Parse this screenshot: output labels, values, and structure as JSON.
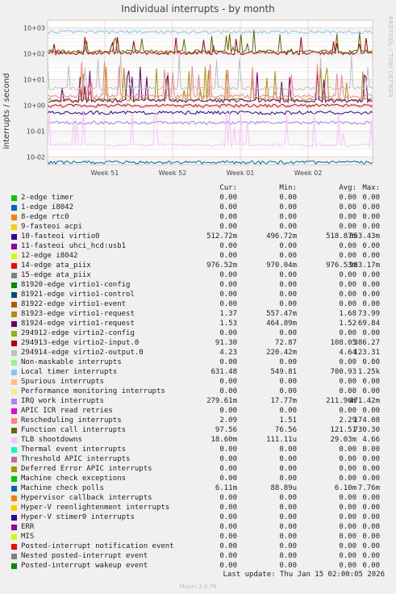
{
  "title": "Individual interrupts - by month",
  "watermark": "RRDTOOL / TOBI OETIKER",
  "footer": {
    "last_update": "Last update: Thu Jan 15 02:00:05 2026",
    "generator": "Munin 2.0.76"
  },
  "columns": {
    "cur": "Cur:",
    "min": "Min:",
    "avg": "Avg:",
    "max": "Max:"
  },
  "chart_data": {
    "type": "line",
    "title": "Individual interrupts - by month",
    "ylabel": "interrupts / second",
    "yscale": "log",
    "y_ticks": [
      {
        "value": 1000,
        "label": "10+03"
      },
      {
        "value": 100,
        "label": "10+02"
      },
      {
        "value": 10,
        "label": "10+01"
      },
      {
        "value": 1,
        "label": "10+00"
      },
      {
        "value": 0.1,
        "label": "10-01"
      },
      {
        "value": 0.01,
        "label": "10-02"
      }
    ],
    "ylim": [
      0.005,
      2000
    ],
    "x_ticks": [
      "Week 51",
      "Week 52",
      "Week 01",
      "Week 02"
    ],
    "grid": true,
    "series": [
      {
        "name": "2-edge timer",
        "color": "#00cc00",
        "cur": "0.00",
        "min": "0.00",
        "avg": "0.00",
        "max": "0.00"
      },
      {
        "name": "1-edge i8042",
        "color": "#0066b3",
        "cur": "0.00",
        "min": "0.00",
        "avg": "0.00",
        "max": "0.00"
      },
      {
        "name": "8-edge rtc0",
        "color": "#ff8000",
        "cur": "0.00",
        "min": "0.00",
        "avg": "0.00",
        "max": "0.00"
      },
      {
        "name": "9-fasteoi acpi",
        "color": "#ffcc00",
        "cur": "0.00",
        "min": "0.00",
        "avg": "0.00",
        "max": "0.00"
      },
      {
        "name": "10-fasteoi virtio0",
        "color": "#330099",
        "cur": "512.72m",
        "min": "496.72m",
        "avg": "518.87m",
        "max": "853.43m"
      },
      {
        "name": "11-fasteoi uhci_hcd:usb1",
        "color": "#990099",
        "cur": "0.00",
        "min": "0.00",
        "avg": "0.00",
        "max": "0.00"
      },
      {
        "name": "12-edge i8042",
        "color": "#ccff00",
        "cur": "0.00",
        "min": "0.00",
        "avg": "0.00",
        "max": "0.00"
      },
      {
        "name": "14-edge ata_piix",
        "color": "#ff0000",
        "cur": "976.52m",
        "min": "970.04m",
        "avg": "976.53m",
        "max": "983.17m"
      },
      {
        "name": "15-edge ata_piix",
        "color": "#808080",
        "cur": "0.00",
        "min": "0.00",
        "avg": "0.00",
        "max": "0.00"
      },
      {
        "name": "81920-edge virtio1-config",
        "color": "#008f00",
        "cur": "0.00",
        "min": "0.00",
        "avg": "0.00",
        "max": "0.00"
      },
      {
        "name": "81921-edge virtio1-control",
        "color": "#00487d",
        "cur": "0.00",
        "min": "0.00",
        "avg": "0.00",
        "max": "0.00"
      },
      {
        "name": "81922-edge virtio1-event",
        "color": "#b35a00",
        "cur": "0.00",
        "min": "0.00",
        "avg": "0.00",
        "max": "0.00"
      },
      {
        "name": "81923-edge virtio1-request",
        "color": "#b38f00",
        "cur": "1.37",
        "min": "557.47m",
        "avg": "1.68",
        "max": "73.99"
      },
      {
        "name": "81924-edge virtio1-request",
        "color": "#6b006b",
        "cur": "1.53",
        "min": "464.89m",
        "avg": "1.52",
        "max": "69.84"
      },
      {
        "name": "294912-edge virtio2-config",
        "color": "#8fb300",
        "cur": "0.00",
        "min": "0.00",
        "avg": "0.00",
        "max": "0.00"
      },
      {
        "name": "294913-edge virtio2-input.0",
        "color": "#b30000",
        "cur": "91.30",
        "min": "72.87",
        "avg": "108.05",
        "max": "386.27"
      },
      {
        "name": "294914-edge virtio2-output.0",
        "color": "#bebebe",
        "cur": "4.23",
        "min": "220.42m",
        "avg": "4.64",
        "max": "123.31"
      },
      {
        "name": "Non-maskable interrupts",
        "color": "#80ff80",
        "cur": "0.00",
        "min": "0.00",
        "avg": "0.00",
        "max": "0.00"
      },
      {
        "name": "Local timer interrupts",
        "color": "#80c9ff",
        "cur": "631.48",
        "min": "549.81",
        "avg": "700.93",
        "max": "1.25k"
      },
      {
        "name": "Spurious interrupts",
        "color": "#ffc080",
        "cur": "0.00",
        "min": "0.00",
        "avg": "0.00",
        "max": "0.00"
      },
      {
        "name": "Performance monitoring interrupts",
        "color": "#ffe680",
        "cur": "0.00",
        "min": "0.00",
        "avg": "0.00",
        "max": "0.00"
      },
      {
        "name": "IRQ work interrupts",
        "color": "#aa80ff",
        "cur": "279.61m",
        "min": "17.77m",
        "avg": "211.96m",
        "max": "471.42m"
      },
      {
        "name": "APIC ICR read retries",
        "color": "#ee00cc",
        "cur": "0.00",
        "min": "0.00",
        "avg": "0.00",
        "max": "0.00"
      },
      {
        "name": "Rescheduling interrupts",
        "color": "#ff8080",
        "cur": "2.09",
        "min": "1.51",
        "avg": "2.29",
        "max": "174.08"
      },
      {
        "name": "Function call interrupts",
        "color": "#666600",
        "cur": "97.56",
        "min": "76.56",
        "avg": "121.51",
        "max": "730.30"
      },
      {
        "name": "TLB shootdowns",
        "color": "#ffbfff",
        "cur": "18.60m",
        "min": "111.11u",
        "avg": "29.03m",
        "max": "4.66"
      },
      {
        "name": "Thermal event interrupts",
        "color": "#00ffcc",
        "cur": "0.00",
        "min": "0.00",
        "avg": "0.00",
        "max": "0.00"
      },
      {
        "name": "Threshold APIC interrupts",
        "color": "#cc6699",
        "cur": "0.00",
        "min": "0.00",
        "avg": "0.00",
        "max": "0.00"
      },
      {
        "name": "Deferred Error APIC interrupts",
        "color": "#999900",
        "cur": "0.00",
        "min": "0.00",
        "avg": "0.00",
        "max": "0.00"
      },
      {
        "name": "Machine check exceptions",
        "color": "#00cc00",
        "cur": "0.00",
        "min": "0.00",
        "avg": "0.00",
        "max": "0.00"
      },
      {
        "name": "Machine check polls",
        "color": "#0066b3",
        "cur": "6.11m",
        "min": "88.89u",
        "avg": "6.10m",
        "max": "7.76m"
      },
      {
        "name": "Hypervisor callback interrupts",
        "color": "#ff8000",
        "cur": "0.00",
        "min": "0.00",
        "avg": "0.00",
        "max": "0.00"
      },
      {
        "name": "Hyper-V reenlightenment interrupts",
        "color": "#ffcc00",
        "cur": "0.00",
        "min": "0.00",
        "avg": "0.00",
        "max": "0.00"
      },
      {
        "name": "Hyper-V stimer0 interrupts",
        "color": "#330099",
        "cur": "0.00",
        "min": "0.00",
        "avg": "0.00",
        "max": "0.00"
      },
      {
        "name": "ERR",
        "color": "#990099",
        "cur": "0.00",
        "min": "0.00",
        "avg": "0.00",
        "max": "0.00"
      },
      {
        "name": "MIS",
        "color": "#ccff00",
        "cur": "0.00",
        "min": "0.00",
        "avg": "0.00",
        "max": "0.00"
      },
      {
        "name": "Posted-interrupt notification event",
        "color": "#ff0000",
        "cur": "0.00",
        "min": "0.00",
        "avg": "0.00",
        "max": "0.00"
      },
      {
        "name": "Nested posted-interrupt event",
        "color": "#808080",
        "cur": "0.00",
        "min": "0.00",
        "avg": "0.00",
        "max": "0.00"
      },
      {
        "name": "Posted-interrupt wakeup event",
        "color": "#008f00",
        "cur": "0.00",
        "min": "0.00",
        "avg": "0.00",
        "max": "0.00"
      }
    ]
  }
}
